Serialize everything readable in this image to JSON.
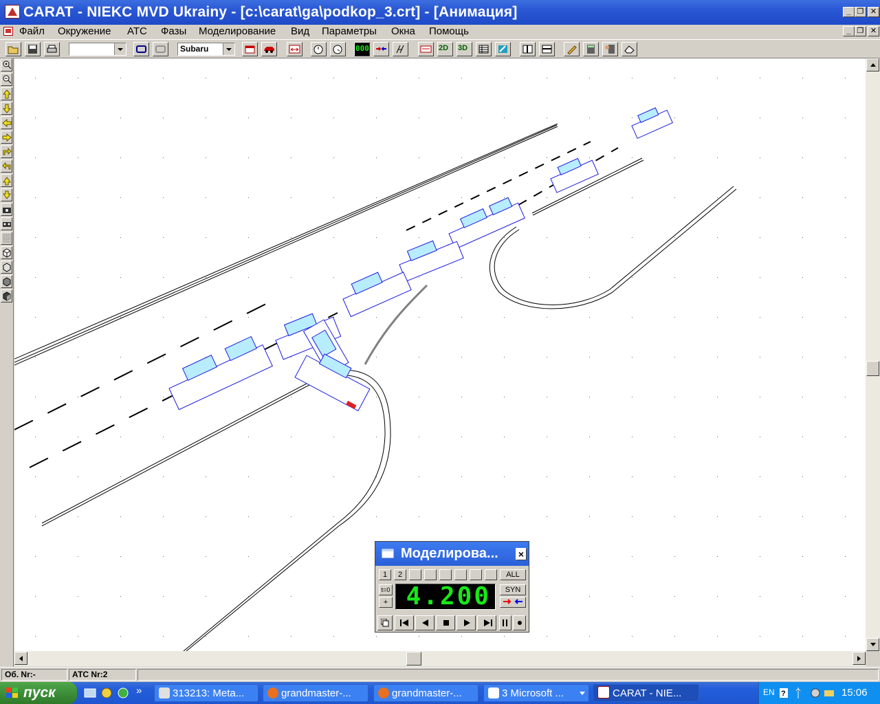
{
  "window": {
    "title": "CARAT - NIEKC MVD Ukrainy - [c:\\carat\\ga\\podkop_3.crt] - [Анимация]",
    "min_label": "_",
    "restore_label": "❐",
    "close_label": "✕"
  },
  "menu": {
    "items": [
      "Файл",
      "Окружение",
      "АТС",
      "Фазы",
      "Моделирование",
      "Вид",
      "Параметры",
      "Окна",
      "Помощь"
    ]
  },
  "toolbar": {
    "combo1_value": "",
    "combo2_value": "Subaru",
    "btn_2d": "2D",
    "btn_3d": "3D",
    "btn_000": "000"
  },
  "status": {
    "ob_nr": "Об. Nr:-",
    "ats_nr": "АТС Nr:2"
  },
  "sim_panel": {
    "title": "Моделирова...",
    "close_label": "×",
    "slot_labels": [
      "1",
      "2",
      "",
      "",
      "",
      "",
      "",
      ""
    ],
    "all_label": "ALL",
    "t0_label": "t=0",
    "plus_label": "+",
    "time_value": "4.200",
    "syn_label": "SYN"
  },
  "taskbar": {
    "start_label": "пуск",
    "quicklaunch_more": "»",
    "tasks": [
      {
        "label": "313213: Meta..."
      },
      {
        "label": "grandmaster-..."
      },
      {
        "label": "grandmaster-..."
      },
      {
        "label": "3 Microsoft ..."
      },
      {
        "label": "CARAT - NIE..."
      }
    ],
    "lang": "EN",
    "clock": "15:06"
  },
  "colors": {
    "car_wire": "#1b1be0",
    "car_glass": "#00b8f0",
    "lcd_text": "#18e818",
    "title_blue": "#2a57d4"
  }
}
